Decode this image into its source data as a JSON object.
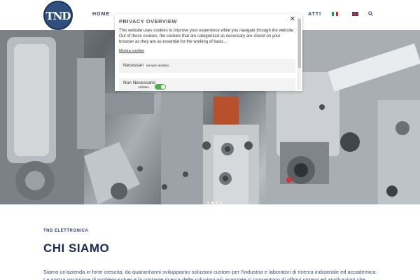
{
  "header": {
    "logo_text": "TND",
    "nav_home": "HOME",
    "nav_atti": "ATTI",
    "languages": [
      "it-flag-icon",
      "en-flag-icon"
    ],
    "search_icon": "search-icon"
  },
  "hero": {
    "slide_dots": 4,
    "active_dot": 1
  },
  "content": {
    "eyebrow": "TND ELETTRONICA",
    "title": "CHI SIAMO",
    "body": "Siamo un'azienda in forte crescita, da quarant'anni sviluppiamo soluzioni custom per l'industria e laboratori di ricerca industriale ed accademica. La nostra vocazione di problem-solver e la costante ricerca delle soluzioni più avanzate ci consentono di offrirvi sistemi ed applicazioni che spaziano"
  },
  "privacy": {
    "title": "PRIVACY OVERVIEW",
    "close_icon": "close-icon",
    "description": "This website uses cookies to improve your experience while you navigate through the website. Out of these cookies, the cookies that are categorized as necessary are stored on your browser as they are as essential for the working of basic...",
    "show_more": "Mostra confine",
    "rows": [
      {
        "name": "Necessari",
        "status": "Sempre abilitato"
      },
      {
        "name": "Non Necessario",
        "status": "Abilitato",
        "toggle_on": true
      }
    ]
  },
  "colors": {
    "brand_navy": "#1d2a5c",
    "nav_blue": "#2e3b7a",
    "toggle_green": "#4caf50"
  }
}
